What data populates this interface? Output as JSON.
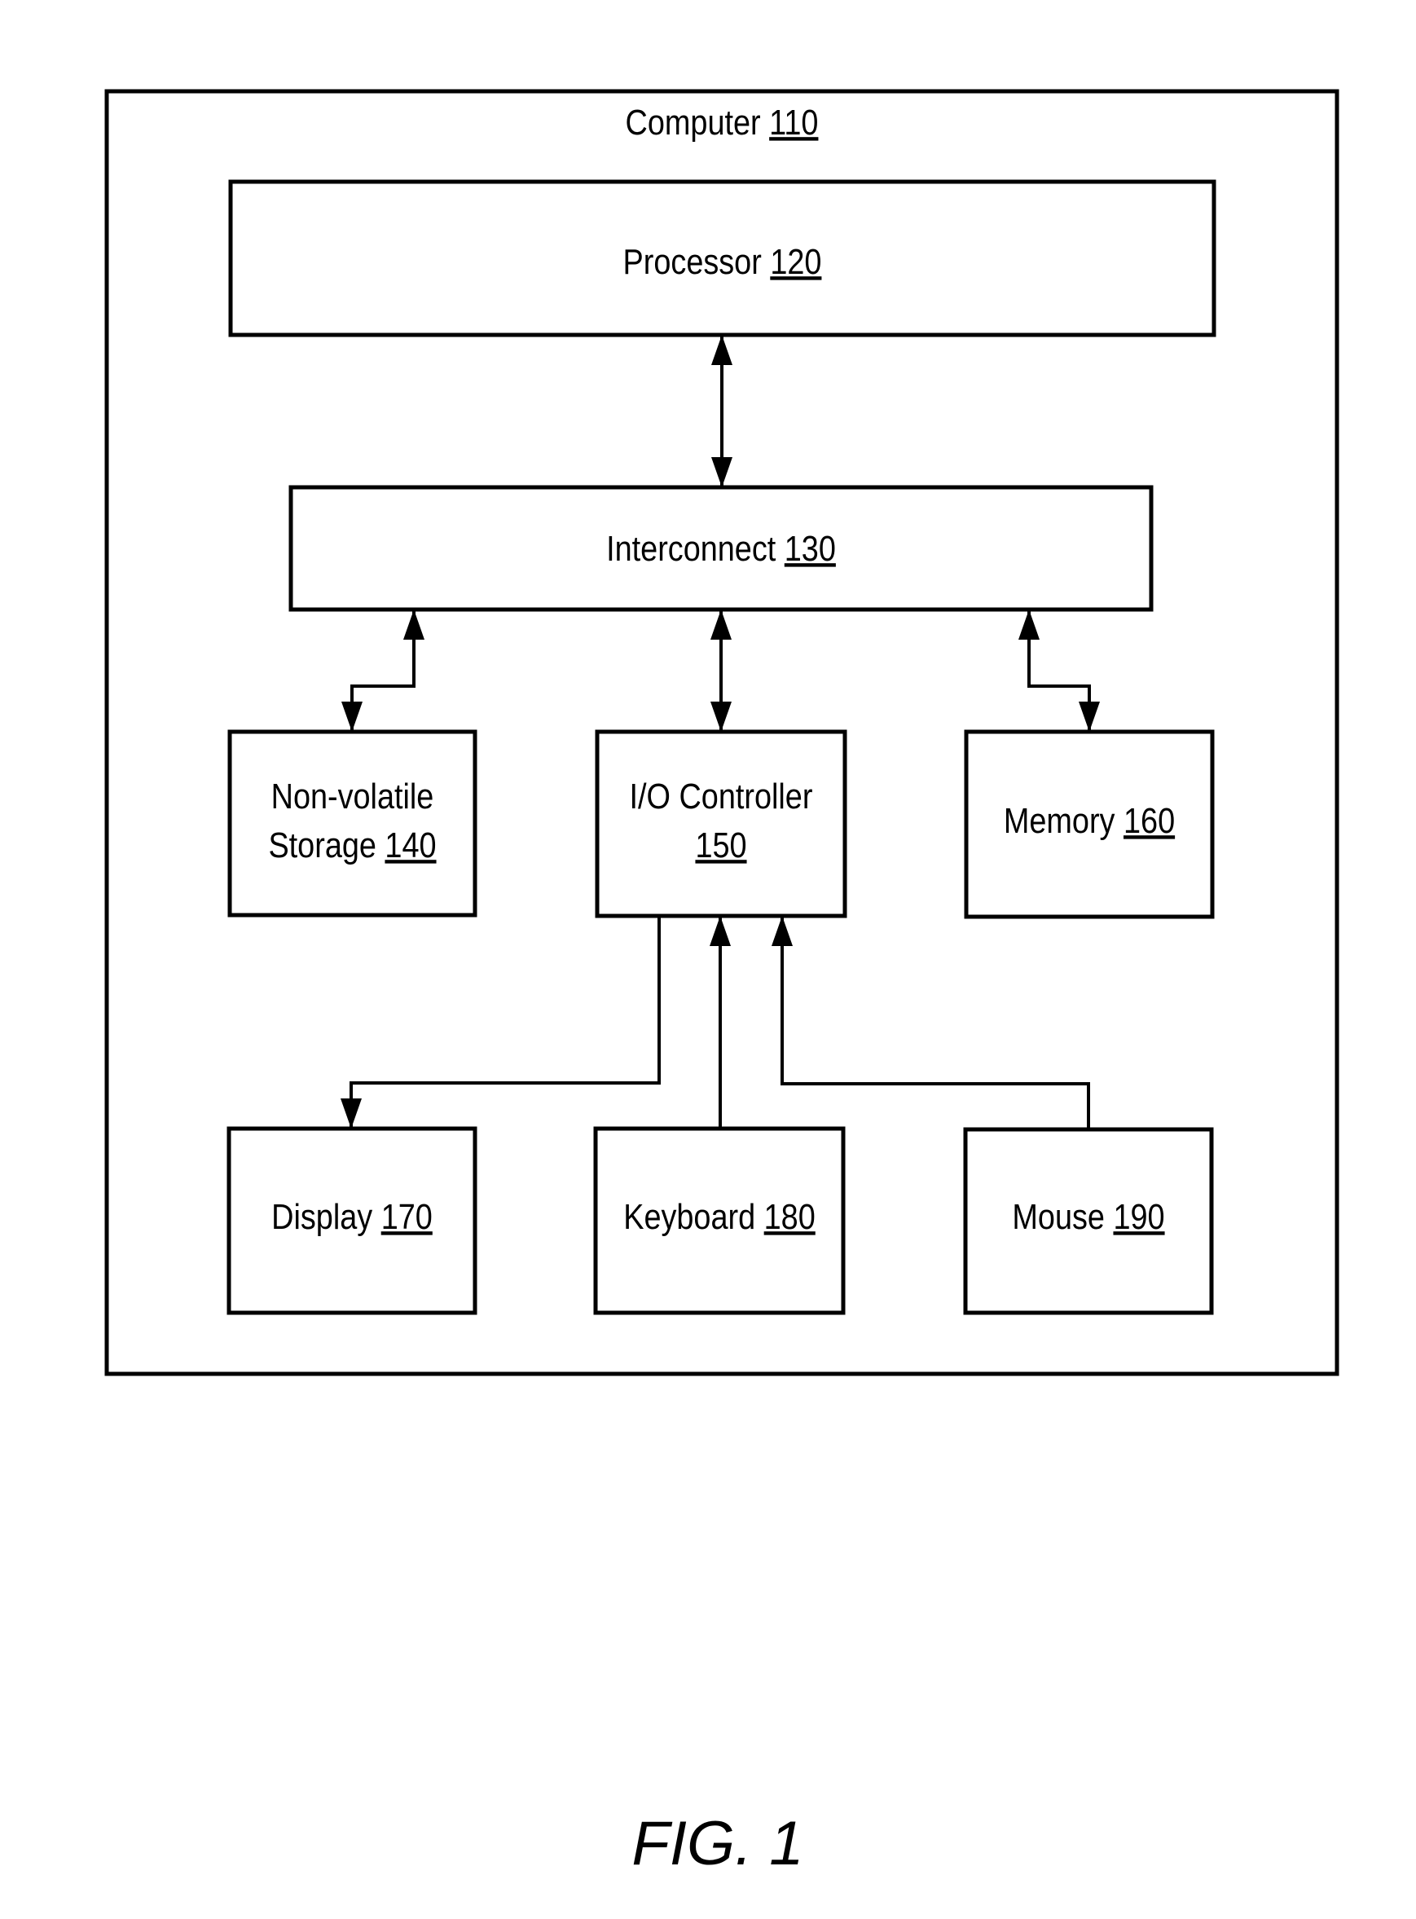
{
  "figure": {
    "caption": "FIG. 1"
  },
  "container": {
    "label": "Computer",
    "ref": "110"
  },
  "nodes": [
    {
      "id": "processor",
      "lines": [
        {
          "text": "Processor ",
          "ref": "120"
        }
      ]
    },
    {
      "id": "interconnect",
      "lines": [
        {
          "text": "Interconnect ",
          "ref": "130"
        }
      ]
    },
    {
      "id": "storage",
      "lines": [
        {
          "text": "Non-volatile",
          "ref": ""
        },
        {
          "text": "Storage ",
          "ref": "140"
        }
      ]
    },
    {
      "id": "io-controller",
      "lines": [
        {
          "text": "I/O Controller",
          "ref": ""
        },
        {
          "text": "",
          "ref": "150"
        }
      ]
    },
    {
      "id": "memory",
      "lines": [
        {
          "text": "Memory ",
          "ref": "160"
        }
      ]
    },
    {
      "id": "display",
      "lines": [
        {
          "text": "Display ",
          "ref": "170"
        }
      ]
    },
    {
      "id": "keyboard",
      "lines": [
        {
          "text": "Keyboard ",
          "ref": "180"
        }
      ]
    },
    {
      "id": "mouse",
      "lines": [
        {
          "text": "Mouse ",
          "ref": "190"
        }
      ]
    }
  ],
  "edges": [
    {
      "from": "processor",
      "to": "interconnect",
      "direction": "bidirectional"
    },
    {
      "from": "interconnect",
      "to": "storage",
      "direction": "bidirectional"
    },
    {
      "from": "interconnect",
      "to": "io-controller",
      "direction": "bidirectional"
    },
    {
      "from": "interconnect",
      "to": "memory",
      "direction": "bidirectional"
    },
    {
      "from": "io-controller",
      "to": "display",
      "direction": "forward"
    },
    {
      "from": "keyboard",
      "to": "io-controller",
      "direction": "forward"
    },
    {
      "from": "mouse",
      "to": "io-controller",
      "direction": "forward"
    }
  ]
}
